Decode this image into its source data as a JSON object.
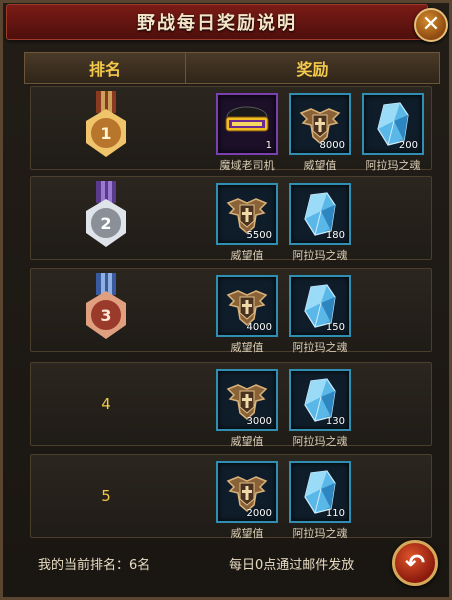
{
  "window": {
    "title": "野战每日奖励说明",
    "close_icon": "close-icon"
  },
  "table": {
    "headers": {
      "rank": "排名",
      "reward": "奖励"
    },
    "rows": [
      {
        "rank": "1",
        "medal": "gold-medal-icon",
        "rewards": [
          {
            "name": "魔域老司机",
            "count": "1",
            "icon": "title-badge-icon",
            "frame": "purple"
          },
          {
            "name": "威望值",
            "count": "8000",
            "icon": "prestige-shield-icon",
            "frame": "blue"
          },
          {
            "name": "阿拉玛之魂",
            "count": "200",
            "icon": "crystal-icon",
            "frame": "blue"
          }
        ]
      },
      {
        "rank": "2",
        "medal": "silver-medal-icon",
        "rewards": [
          {
            "name": "威望值",
            "count": "5500",
            "icon": "prestige-shield-icon",
            "frame": "blue"
          },
          {
            "name": "阿拉玛之魂",
            "count": "180",
            "icon": "crystal-icon",
            "frame": "blue"
          }
        ]
      },
      {
        "rank": "3",
        "medal": "bronze-medal-icon",
        "rewards": [
          {
            "name": "威望值",
            "count": "4000",
            "icon": "prestige-shield-icon",
            "frame": "blue"
          },
          {
            "name": "阿拉玛之魂",
            "count": "150",
            "icon": "crystal-icon",
            "frame": "blue"
          }
        ]
      },
      {
        "rank": "4",
        "medal": "",
        "rewards": [
          {
            "name": "威望值",
            "count": "3000",
            "icon": "prestige-shield-icon",
            "frame": "blue"
          },
          {
            "name": "阿拉玛之魂",
            "count": "130",
            "icon": "crystal-icon",
            "frame": "blue"
          }
        ]
      },
      {
        "rank": "5",
        "medal": "",
        "rewards": [
          {
            "name": "威望值",
            "count": "2000",
            "icon": "prestige-shield-icon",
            "frame": "blue"
          },
          {
            "name": "阿拉玛之魂",
            "count": "110",
            "icon": "crystal-icon",
            "frame": "blue"
          }
        ]
      }
    ]
  },
  "footer": {
    "current_rank": "我的当前排名：6名",
    "mail_note": "每日0点通过邮件发放",
    "back_icon": "back-arrow-icon"
  },
  "colors": {
    "title_bar": "#7b1b16",
    "header_text": "#f2c94a",
    "slot_blue": "#2f8fb3",
    "slot_purple": "#7a3fb0"
  }
}
